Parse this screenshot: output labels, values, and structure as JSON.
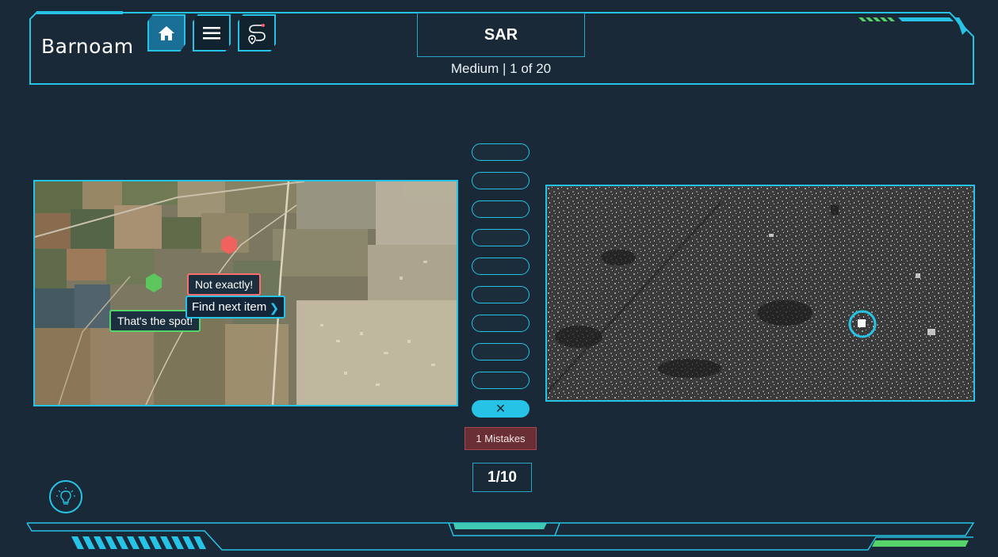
{
  "app": {
    "logo_text": "Barnoam",
    "title": "SAR",
    "subtitle": "Medium | 1 of 20"
  },
  "nav": [
    {
      "name": "home-button",
      "icon": "home-icon"
    },
    {
      "name": "menu-button",
      "icon": "hamburger-icon"
    },
    {
      "name": "route-button",
      "icon": "route-pin-icon"
    }
  ],
  "left_map": {
    "tooltip_not": "Not exactly!",
    "tooltip_spot": "That's the spot!",
    "next_label": "Find next item"
  },
  "progress": {
    "slots_total": 10,
    "slots_marked_wrong": 1,
    "wrong_symbol": "✕"
  },
  "mistakes_label": "1 Mistakes",
  "counter": "1/10",
  "hint": {
    "icon": "lightbulb-icon"
  },
  "colors": {
    "background": "#192937",
    "accent": "#27c3e6",
    "wrong": "#ff6e6e",
    "correct": "#56d46a",
    "mistake_bg": "#6a2e35"
  }
}
